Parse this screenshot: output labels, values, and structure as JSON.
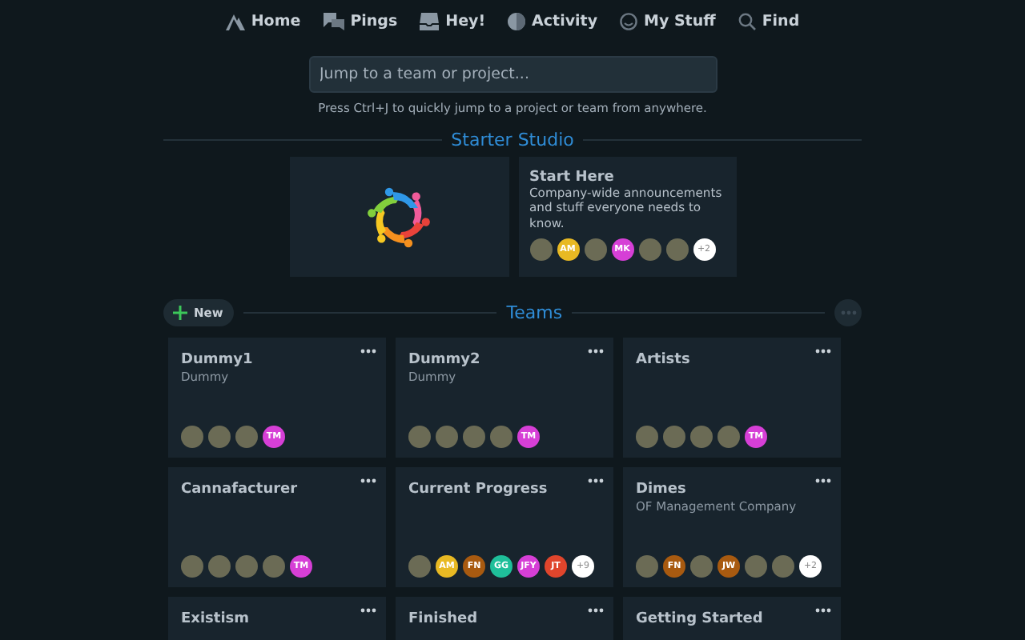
{
  "nav": [
    {
      "kind": "home",
      "label": "Home"
    },
    {
      "kind": "pings",
      "label": "Pings"
    },
    {
      "kind": "hey",
      "label": "Hey!"
    },
    {
      "kind": "activity",
      "label": "Activity"
    },
    {
      "kind": "mystuff",
      "label": "My Stuff"
    },
    {
      "kind": "find",
      "label": "Find"
    }
  ],
  "jump": {
    "placeholder": "Jump to a team or project...",
    "hint": "Press Ctrl+J to quickly jump to a project or team from anywhere."
  },
  "studio": {
    "title": "Starter Studio",
    "name": "Start Here",
    "description": "Company-wide announcements and stuff everyone needs to know.",
    "avatars": [
      {
        "kind": "photo"
      },
      {
        "kind": "initials",
        "text": "AM",
        "color": "#e8b923"
      },
      {
        "kind": "photo"
      },
      {
        "kind": "initials",
        "text": "MK",
        "color": "#d63fd6"
      },
      {
        "kind": "photo"
      },
      {
        "kind": "photo"
      },
      {
        "kind": "more",
        "text": "+2"
      }
    ]
  },
  "teams": {
    "title": "Teams",
    "new_label": "New",
    "cards": [
      {
        "name": "Dummy1",
        "subtitle": "Dummy",
        "avatars": [
          {
            "kind": "photo"
          },
          {
            "kind": "photo"
          },
          {
            "kind": "photo"
          },
          {
            "kind": "initials",
            "text": "TM",
            "color": "#d63fd6"
          }
        ]
      },
      {
        "name": "Dummy2",
        "subtitle": "Dummy",
        "avatars": [
          {
            "kind": "photo"
          },
          {
            "kind": "photo"
          },
          {
            "kind": "photo"
          },
          {
            "kind": "photo"
          },
          {
            "kind": "initials",
            "text": "TM",
            "color": "#d63fd6"
          }
        ]
      },
      {
        "name": "Artists",
        "avatars": [
          {
            "kind": "photo"
          },
          {
            "kind": "photo"
          },
          {
            "kind": "photo"
          },
          {
            "kind": "photo"
          },
          {
            "kind": "initials",
            "text": "TM",
            "color": "#d63fd6"
          }
        ]
      },
      {
        "name": "Cannafacturer",
        "avatars": [
          {
            "kind": "photo"
          },
          {
            "kind": "photo"
          },
          {
            "kind": "photo"
          },
          {
            "kind": "photo"
          },
          {
            "kind": "initials",
            "text": "TM",
            "color": "#d63fd6"
          }
        ]
      },
      {
        "name": "Current Progress",
        "avatars": [
          {
            "kind": "photo"
          },
          {
            "kind": "initials",
            "text": "AM",
            "color": "#e8b923"
          },
          {
            "kind": "initials",
            "text": "FN",
            "color": "#a85a10"
          },
          {
            "kind": "initials",
            "text": "GG",
            "color": "#1fbf9a"
          },
          {
            "kind": "initials",
            "text": "JFY",
            "color": "#d63fd6"
          },
          {
            "kind": "initials",
            "text": "JT",
            "color": "#e0452c"
          },
          {
            "kind": "more",
            "text": "+9"
          }
        ]
      },
      {
        "name": "Dimes",
        "subtitle": "OF Management Company",
        "avatars": [
          {
            "kind": "photo"
          },
          {
            "kind": "initials",
            "text": "FN",
            "color": "#a85a10"
          },
          {
            "kind": "photo"
          },
          {
            "kind": "initials",
            "text": "JW",
            "color": "#a85a10"
          },
          {
            "kind": "photo"
          },
          {
            "kind": "photo"
          },
          {
            "kind": "more",
            "text": "+2"
          }
        ]
      },
      {
        "name": "Existism"
      },
      {
        "name": "Finished"
      },
      {
        "name": "Getting Started"
      }
    ]
  }
}
